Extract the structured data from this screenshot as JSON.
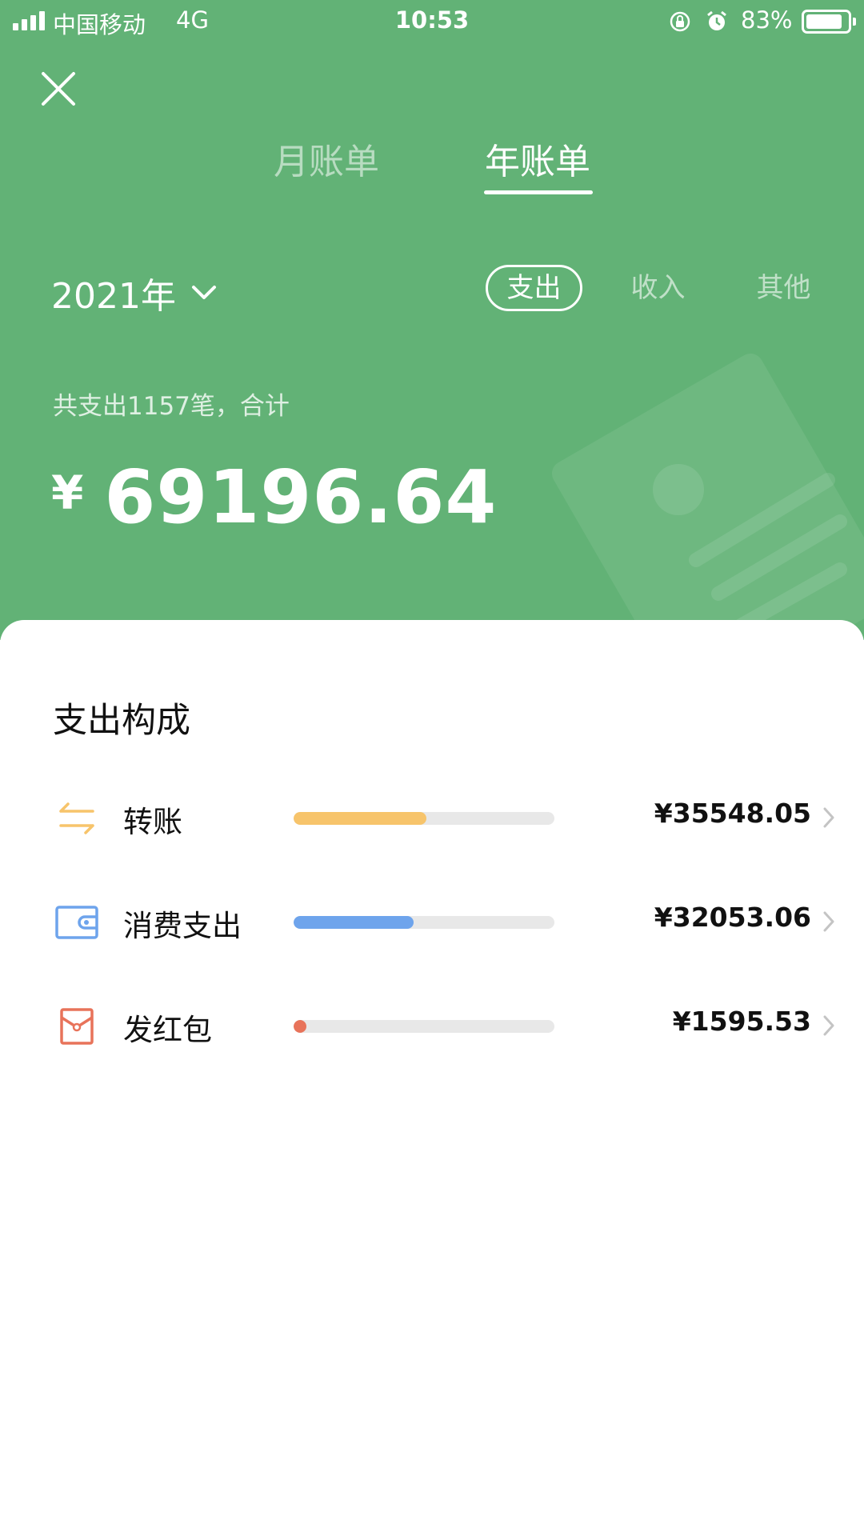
{
  "status_bar": {
    "carrier": "中国移动",
    "network": "4G",
    "time": "10:53",
    "battery": "83%",
    "battery_level": 0.83
  },
  "header": {
    "close_icon": "close-icon",
    "tabs": [
      {
        "label": "月账单",
        "active": false
      },
      {
        "label": "年账单",
        "active": true
      }
    ]
  },
  "filter": {
    "year_label": "2021年",
    "types": [
      {
        "label": "支出",
        "active": true
      },
      {
        "label": "收入",
        "active": false
      },
      {
        "label": "其他",
        "active": false
      }
    ]
  },
  "summary": {
    "text": "共支出1157笔，合计",
    "currency": "¥",
    "total": "69196.64"
  },
  "breakdown": {
    "title": "支出构成",
    "items": [
      {
        "icon": "transfer-icon",
        "label": "转账",
        "amount": "¥35548.05",
        "share": 0.514,
        "color": "#f7c46b"
      },
      {
        "icon": "wallet-icon",
        "label": "消费支出",
        "amount": "¥32053.06",
        "share": 0.463,
        "color": "#6ea4ec"
      },
      {
        "icon": "red-envelope-icon",
        "label": "发红包",
        "amount": "¥1595.53",
        "share": 0.023,
        "color": "#e8735a"
      }
    ]
  },
  "colors": {
    "header_green": "#62b276",
    "transfer": "#f7c46b",
    "consumption": "#6ea4ec",
    "red_envelope": "#e8735a"
  }
}
